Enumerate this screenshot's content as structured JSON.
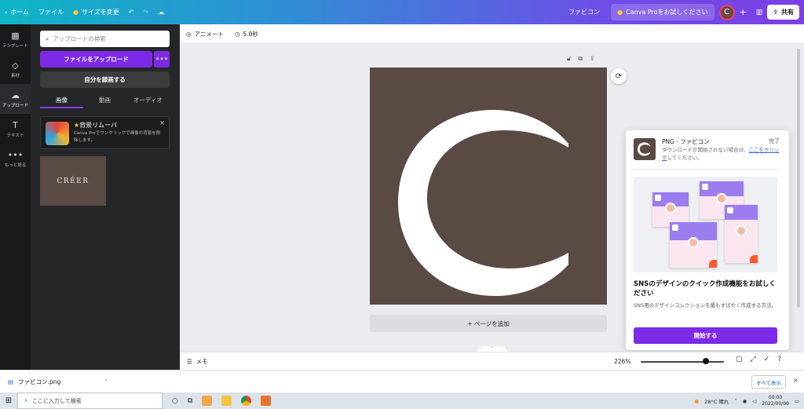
{
  "topbar": {
    "home": "ホーム",
    "file": "ファイル",
    "resize": "サイズを変更",
    "design_name": "ファビコン",
    "pro_cta": "Canva Proをお試しください",
    "avatar_letter": "C",
    "share": "共有"
  },
  "sidebar": {
    "items": [
      {
        "label": "テンプレート",
        "icon": "template-icon"
      },
      {
        "label": "素材",
        "icon": "elements-icon"
      },
      {
        "label": "アップロード",
        "icon": "upload-icon"
      },
      {
        "label": "テキスト",
        "icon": "text-icon"
      },
      {
        "label": "もっと見る",
        "icon": "more-icon"
      }
    ]
  },
  "panel": {
    "search_placeholder": "アップロードの検索",
    "upload_button": "ファイルをアップロード",
    "more_button": "•••",
    "record_button": "自分を録画する",
    "tabs": [
      "画像",
      "動画",
      "オーディオ"
    ],
    "promo_title": "背景リムーバ",
    "promo_desc": "Canva Proでワンクリックで画像の背景を削除します。",
    "uploaded_text": "CRÉER"
  },
  "editor": {
    "animate": "アニメート",
    "duration": "5.0秒",
    "add_page": "+ ページを追加",
    "logo_letter": "C"
  },
  "popup": {
    "title": "PNG · ファビコン",
    "done": "完了",
    "desc_prefix": "ダウンロードが開始されない場合は、",
    "desc_link": "ここをクリック",
    "desc_suffix": "してください。",
    "heading": "SNSのデザインのクイック作成機能をお試しください",
    "sub": "SNS用のデザインコレクションを最もすばやく作成する方法。",
    "button": "開始する"
  },
  "bottom": {
    "memo": "メモ",
    "zoom": "226%",
    "zoom_level": 0.78
  },
  "download_bar": {
    "filename": "ファビコン.png",
    "show_all": "すべて表示"
  },
  "taskbar": {
    "search": "ここに入力して検索",
    "weather": "28°C 晴れ",
    "time": "00:00",
    "date": "2022/00/00"
  },
  "colors": {
    "accent": "#7d2ae8",
    "logo_bg": "#5a4a44"
  }
}
